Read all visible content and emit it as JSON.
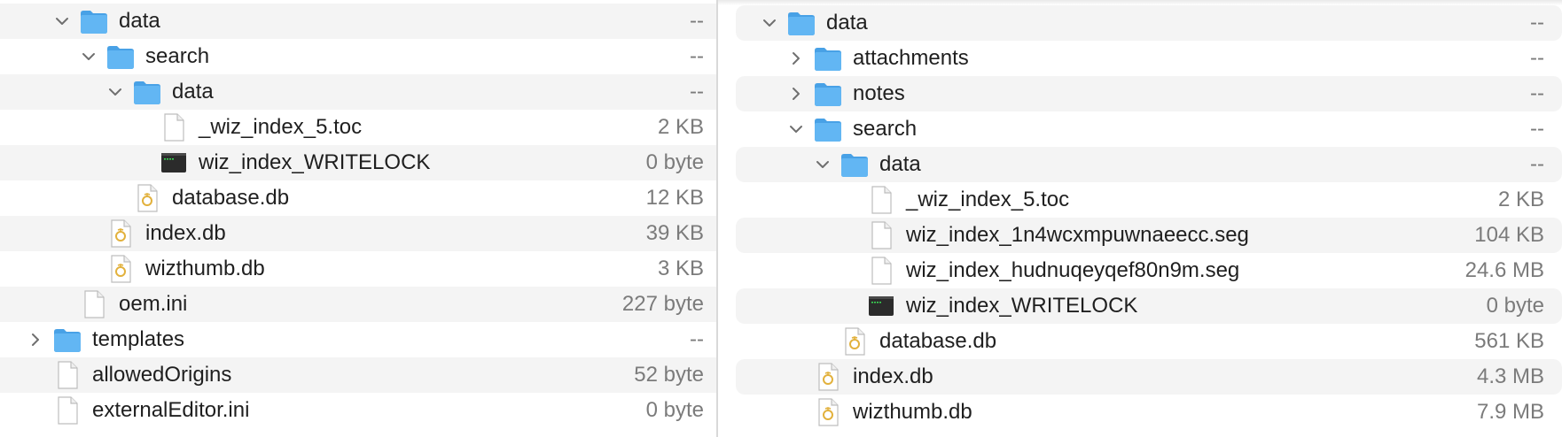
{
  "left_pane": {
    "rows": [
      {
        "name": "data",
        "size": "--",
        "kind": "folder",
        "disclosure": "expanded",
        "depth": 2
      },
      {
        "name": "search",
        "size": "--",
        "kind": "folder",
        "disclosure": "expanded",
        "depth": 3
      },
      {
        "name": "data",
        "size": "--",
        "kind": "folder",
        "disclosure": "expanded",
        "depth": 4
      },
      {
        "name": "_wiz_index_5.toc",
        "size": "2 KB",
        "kind": "file",
        "disclosure": "none",
        "depth": 5
      },
      {
        "name": "wiz_index_WRITELOCK",
        "size": "0 byte",
        "kind": "exec",
        "disclosure": "none",
        "depth": 5
      },
      {
        "name": "database.db",
        "size": "12 KB",
        "kind": "db",
        "disclosure": "none",
        "depth": 4
      },
      {
        "name": "index.db",
        "size": "39 KB",
        "kind": "db",
        "disclosure": "none",
        "depth": 3
      },
      {
        "name": "wizthumb.db",
        "size": "3 KB",
        "kind": "db",
        "disclosure": "none",
        "depth": 3
      },
      {
        "name": "oem.ini",
        "size": "227 byte",
        "kind": "file",
        "disclosure": "none",
        "depth": 2
      },
      {
        "name": "templates",
        "size": "--",
        "kind": "folder",
        "disclosure": "collapsed",
        "depth": 1
      },
      {
        "name": "allowedOrigins",
        "size": "52 byte",
        "kind": "file",
        "disclosure": "none",
        "depth": 1
      },
      {
        "name": "externalEditor.ini",
        "size": "0 byte",
        "kind": "file",
        "disclosure": "none",
        "depth": 1
      }
    ]
  },
  "right_pane": {
    "rows": [
      {
        "name": "data",
        "size": "--",
        "kind": "folder",
        "disclosure": "expanded",
        "depth": 2
      },
      {
        "name": "attachments",
        "size": "--",
        "kind": "folder",
        "disclosure": "collapsed",
        "depth": 3
      },
      {
        "name": "notes",
        "size": "--",
        "kind": "folder",
        "disclosure": "collapsed",
        "depth": 3
      },
      {
        "name": "search",
        "size": "--",
        "kind": "folder",
        "disclosure": "expanded",
        "depth": 3
      },
      {
        "name": "data",
        "size": "--",
        "kind": "folder",
        "disclosure": "expanded",
        "depth": 4
      },
      {
        "name": "_wiz_index_5.toc",
        "size": "2 KB",
        "kind": "file",
        "disclosure": "none",
        "depth": 5
      },
      {
        "name": "wiz_index_1n4wcxmpuwnaeecc.seg",
        "size": "104 KB",
        "kind": "file",
        "disclosure": "none",
        "depth": 5
      },
      {
        "name": "wiz_index_hudnuqeyqef80n9m.seg",
        "size": "24.6 MB",
        "kind": "file",
        "disclosure": "none",
        "depth": 5
      },
      {
        "name": "wiz_index_WRITELOCK",
        "size": "0 byte",
        "kind": "exec",
        "disclosure": "none",
        "depth": 5
      },
      {
        "name": "database.db",
        "size": "561 KB",
        "kind": "db",
        "disclosure": "none",
        "depth": 4
      },
      {
        "name": "index.db",
        "size": "4.3 MB",
        "kind": "db",
        "disclosure": "none",
        "depth": 3
      },
      {
        "name": "wizthumb.db",
        "size": "7.9 MB",
        "kind": "db",
        "disclosure": "none",
        "depth": 3
      }
    ]
  },
  "colors": {
    "folder": "#5eb3f2",
    "folder_tab": "#48a1e6",
    "row_alt": "#f4f4f4",
    "size_text": "#7b7b7b"
  }
}
